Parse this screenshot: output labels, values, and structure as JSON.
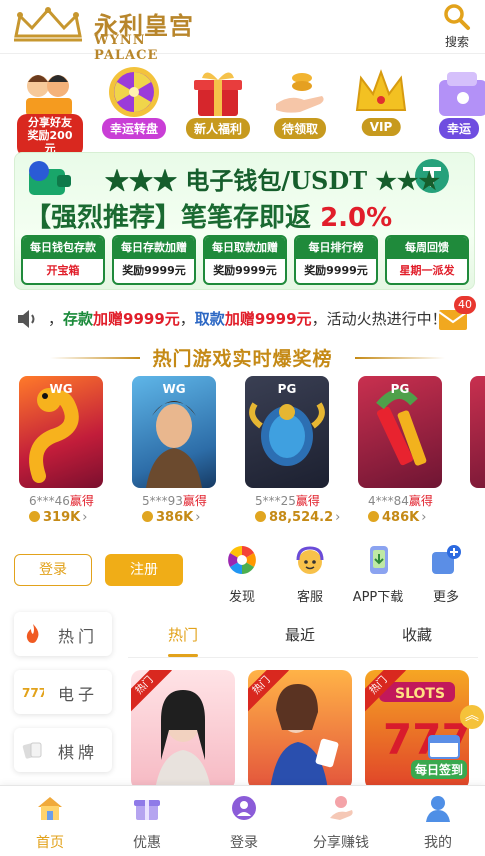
{
  "header": {
    "logo_cn": "永利皇宫",
    "logo_en": "WYNN PALACE",
    "search_label": "搜索"
  },
  "promos": [
    {
      "label": "分享好友奖励200元",
      "icon": "share-friends-icon",
      "color": "#d9281f"
    },
    {
      "label": "幸运转盘",
      "icon": "lucky-wheel-icon",
      "color": "#c93ed6"
    },
    {
      "label": "新人福利",
      "icon": "gift-box-icon",
      "color": "#c79a1e"
    },
    {
      "label": "待领取",
      "icon": "coin-hand-icon",
      "color": "#c79a1e"
    },
    {
      "label": "VIP",
      "icon": "crown-icon",
      "color": "#c79a1e"
    },
    {
      "label": "幸运",
      "icon": "lucky-box-icon",
      "color": "#6f4de0"
    }
  ],
  "banner": {
    "title": "★★★ 电子钱包/USDT ★★★",
    "subtitle": "【强烈推荐】笔笔存即返",
    "rate": "2.0%",
    "cards": [
      {
        "top": "每日钱包存款",
        "bottom": "开宝箱"
      },
      {
        "top": "每日存款加赠",
        "bottom": "奖励9999元"
      },
      {
        "top": "每日取款加赠",
        "bottom": "奖励9999元"
      },
      {
        "top": "每日排行榜",
        "bottom": "奖励9999元"
      },
      {
        "top": "每周回馈",
        "bottom": "星期一派发"
      }
    ]
  },
  "marquee": {
    "prefix": "，",
    "deposit": "存款",
    "deposit_bonus": "加赠9999元",
    "sep": "，",
    "withdraw": "取款",
    "withdraw_bonus": "加赠9999元",
    "suffix": "，活动火热进行中！",
    "mail_count": "40"
  },
  "hot_heading": "热门游戏实时爆奖榜",
  "wins": [
    {
      "provider": "WG",
      "user": "6***46",
      "gain": "赢得",
      "amount": "319K"
    },
    {
      "provider": "WG",
      "user": "5***93",
      "gain": "赢得",
      "amount": "386K"
    },
    {
      "provider": "PG",
      "user": "5***25",
      "gain": "赢得",
      "amount": "88,524.2"
    },
    {
      "provider": "PG",
      "user": "4***84",
      "gain": "赢得",
      "amount": "486K"
    }
  ],
  "auth": {
    "login": "登录",
    "register": "注册"
  },
  "quick": [
    {
      "label": "发现",
      "icon": "discover-icon"
    },
    {
      "label": "客服",
      "icon": "customer-service-icon"
    },
    {
      "label": "APP下载",
      "icon": "app-download-icon"
    },
    {
      "label": "更多",
      "icon": "more-icon"
    }
  ],
  "categories": [
    {
      "label": "热门",
      "icon": "fire-icon"
    },
    {
      "label": "电子",
      "icon": "slot-777-icon"
    },
    {
      "label": "棋牌",
      "icon": "cards-icon"
    }
  ],
  "tabs": [
    "热门",
    "最近",
    "收藏"
  ],
  "game_tag": "热门",
  "checkin": "每日签到",
  "bottom_nav": [
    {
      "label": "首页",
      "icon": "home-icon"
    },
    {
      "label": "优惠",
      "icon": "gift-icon"
    },
    {
      "label": "登录",
      "icon": "login-icon"
    },
    {
      "label": "分享赚钱",
      "icon": "share-money-icon"
    },
    {
      "label": "我的",
      "icon": "profile-icon"
    }
  ]
}
